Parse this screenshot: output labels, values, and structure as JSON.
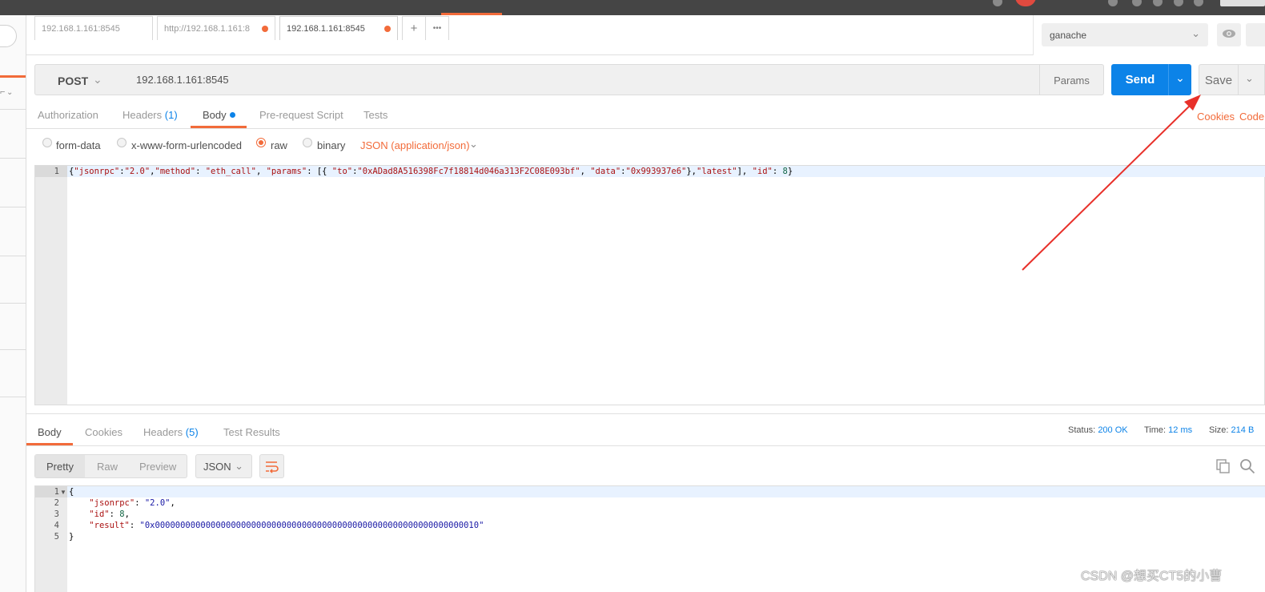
{
  "tabs": [
    {
      "label": "192.168.1.161:8545",
      "unsaved": false
    },
    {
      "label": "http://192.168.1.161:8",
      "unsaved": true
    },
    {
      "label": "192.168.1.161:8545",
      "unsaved": true,
      "active": true
    }
  ],
  "tab_controls": {
    "add": "+",
    "more": "•••"
  },
  "environment": {
    "selected": "ganache"
  },
  "request": {
    "method": "POST",
    "url": "192.168.1.161:8545",
    "params_label": "Params",
    "send_label": "Send",
    "save_label": "Save"
  },
  "request_tabs": {
    "authorization": "Authorization",
    "headers": "Headers",
    "headers_count": "(1)",
    "body": "Body",
    "pre_request": "Pre-request Script",
    "tests": "Tests",
    "cookies": "Cookies",
    "code": "Code"
  },
  "body_options": {
    "form_data": "form-data",
    "urlencoded": "x-www-form-urlencoded",
    "raw": "raw",
    "binary": "binary",
    "selected": "raw",
    "content_type": "JSON (application/json)"
  },
  "request_body": {
    "line_number": "1",
    "p1": "{",
    "k_jsonrpc": "\"jsonrpc\"",
    "v_jsonrpc": "\"2.0\"",
    "k_method": "\"method\"",
    "v_method": "\"eth_call\"",
    "k_params": "\"params\"",
    "k_to": "\"to\"",
    "v_to": "\"0xADad8A516398Fc7f18814d046a313F2C08E093bf\"",
    "k_data": "\"data\"",
    "v_data": "\"0x993937e6\"",
    "v_latest": "\"latest\"",
    "k_id": "\"id\"",
    "v_id": "8"
  },
  "response_tabs": {
    "body": "Body",
    "cookies": "Cookies",
    "headers": "Headers",
    "headers_count": "(5)",
    "test_results": "Test Results"
  },
  "response_meta": {
    "status_label": "Status:",
    "status_value": "200 OK",
    "time_label": "Time:",
    "time_value": "12 ms",
    "size_label": "Size:",
    "size_value": "214 B"
  },
  "response_view": {
    "pretty": "Pretty",
    "raw": "Raw",
    "preview": "Preview",
    "format": "JSON"
  },
  "response_body": {
    "line_numbers": [
      "1",
      "2",
      "3",
      "4",
      "5"
    ],
    "open": "{",
    "k_jsonrpc": "\"jsonrpc\"",
    "v_jsonrpc": "\"2.0\"",
    "k_id": "\"id\"",
    "v_id": "8",
    "k_result": "\"result\"",
    "v_result": "\"0x0000000000000000000000000000000000000000000000000000000000000010\"",
    "close": "}"
  },
  "watermark": "CSDN @想买CT5的小曹",
  "colors": {
    "accent": "#f26b3a",
    "send_blue": "#0c83e8",
    "annotation_arrow": "#e8302a"
  },
  "icons": [
    "eye-icon",
    "gear-icon",
    "chevron-down-icon",
    "wrap-icon",
    "copy-icon",
    "search-icon",
    "plus-icon",
    "more-icon"
  ]
}
